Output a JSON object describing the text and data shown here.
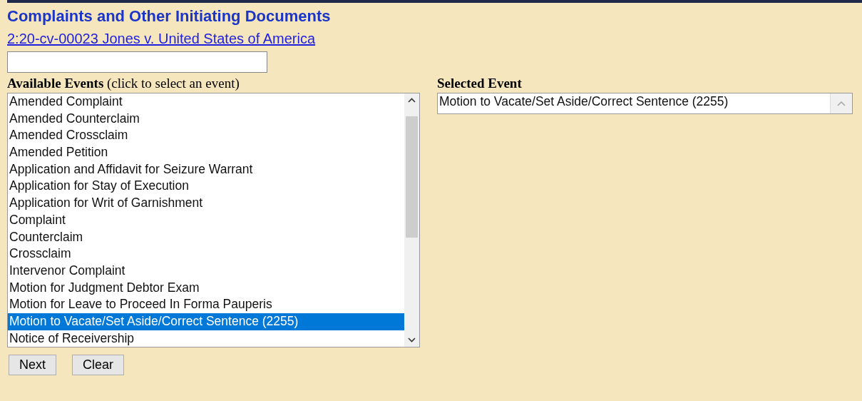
{
  "title": "Complaints and Other Initiating Documents",
  "case_link": "2:20-cv-00023 Jones v. United States of America",
  "available": {
    "label": "**Available Events** (click to select an event)",
    "items": [
      {
        "label": "Amended Complaint",
        "selected": false
      },
      {
        "label": "Amended Counterclaim",
        "selected": false
      },
      {
        "label": "Amended Crossclaim",
        "selected": false
      },
      {
        "label": "Amended Petition",
        "selected": false
      },
      {
        "label": "Application and Affidavit for Seizure Warrant",
        "selected": false
      },
      {
        "label": "Application for Stay of Execution",
        "selected": false
      },
      {
        "label": "Application for Writ of Garnishment",
        "selected": false
      },
      {
        "label": "Complaint",
        "selected": false
      },
      {
        "label": "Counterclaim",
        "selected": false
      },
      {
        "label": "Crossclaim",
        "selected": false
      },
      {
        "label": "Intervenor Complaint",
        "selected": false
      },
      {
        "label": "Motion for Judgment Debtor Exam",
        "selected": false
      },
      {
        "label": "Motion for Leave to Proceed In Forma Pauperis",
        "selected": false
      },
      {
        "label": "Motion to Vacate/Set Aside/Correct Sentence (2255)",
        "selected": true
      },
      {
        "label": "Notice of Receivership",
        "selected": false
      }
    ]
  },
  "selected_event": {
    "label": "Selected Event",
    "items": [
      "Motion to Vacate/Set Aside/Correct Sentence (2255)"
    ]
  },
  "buttons": [
    "Next",
    "Clear"
  ]
}
